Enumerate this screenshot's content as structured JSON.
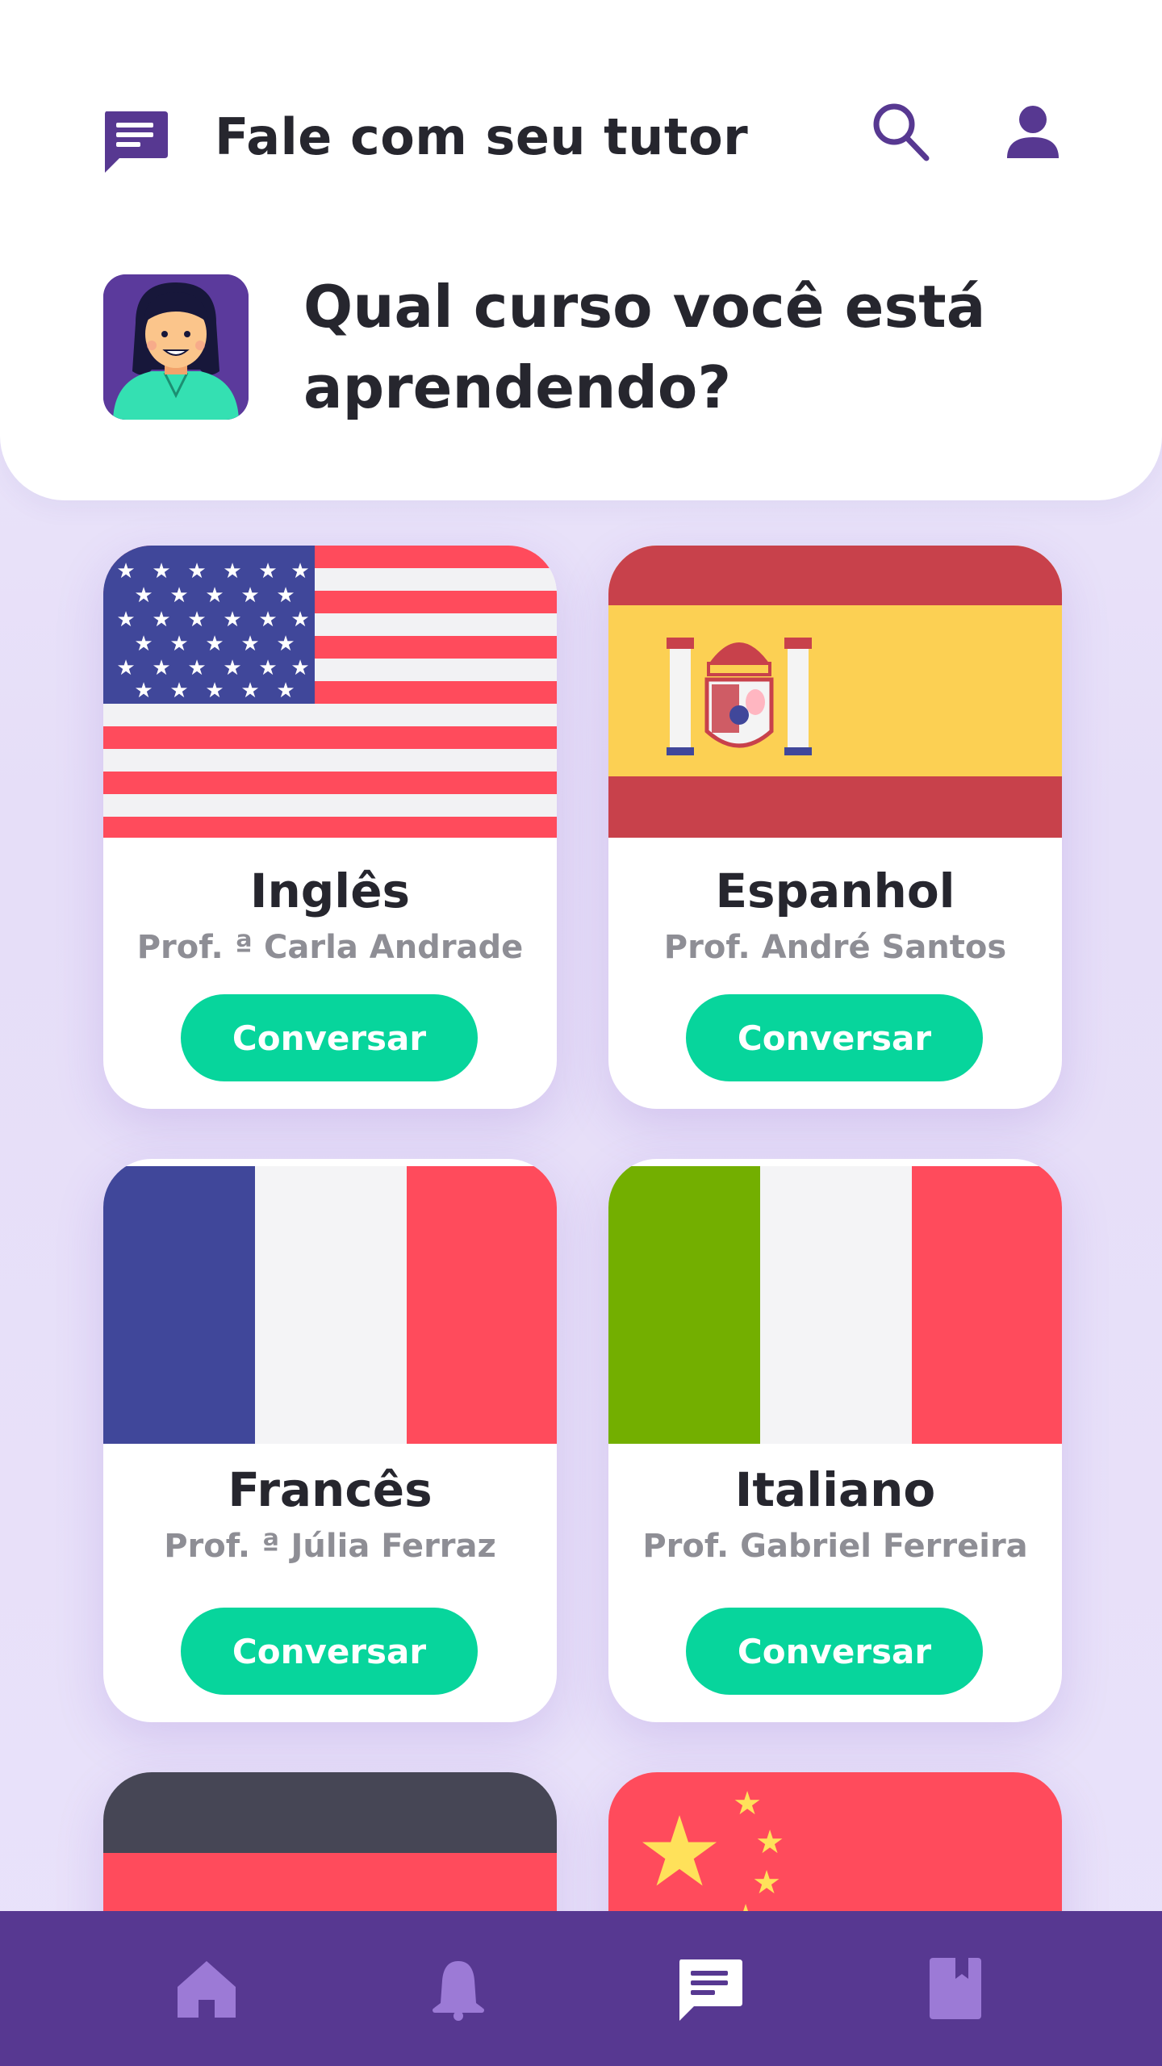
{
  "header": {
    "title": "Fale com seu tutor",
    "question": "Qual curso você está aprendendo?"
  },
  "courses": [
    {
      "name": "Inglês",
      "tutor": "Prof. ª Carla Andrade",
      "button": "Conversar",
      "flag": "usa-flag"
    },
    {
      "name": "Espanhol",
      "tutor": "Prof. André Santos",
      "button": "Conversar",
      "flag": "spain-flag"
    },
    {
      "name": "Francês",
      "tutor": "Prof. ª Júlia Ferraz",
      "button": "Conversar",
      "flag": "france-flag"
    },
    {
      "name": "Italiano",
      "tutor": "Prof. Gabriel Ferreira",
      "button": "Conversar",
      "flag": "italy-flag"
    },
    {
      "flag": "germany-flag"
    },
    {
      "flag": "china-flag"
    }
  ],
  "bottom_nav": {
    "items": [
      "home-icon",
      "bell-icon",
      "chat-icon",
      "book-icon"
    ],
    "active": "chat-icon"
  },
  "colors": {
    "primary_purple": "#573891",
    "accent_green": "#07d59c",
    "text_dark": "#26262e",
    "text_gray": "#8e8e95"
  }
}
